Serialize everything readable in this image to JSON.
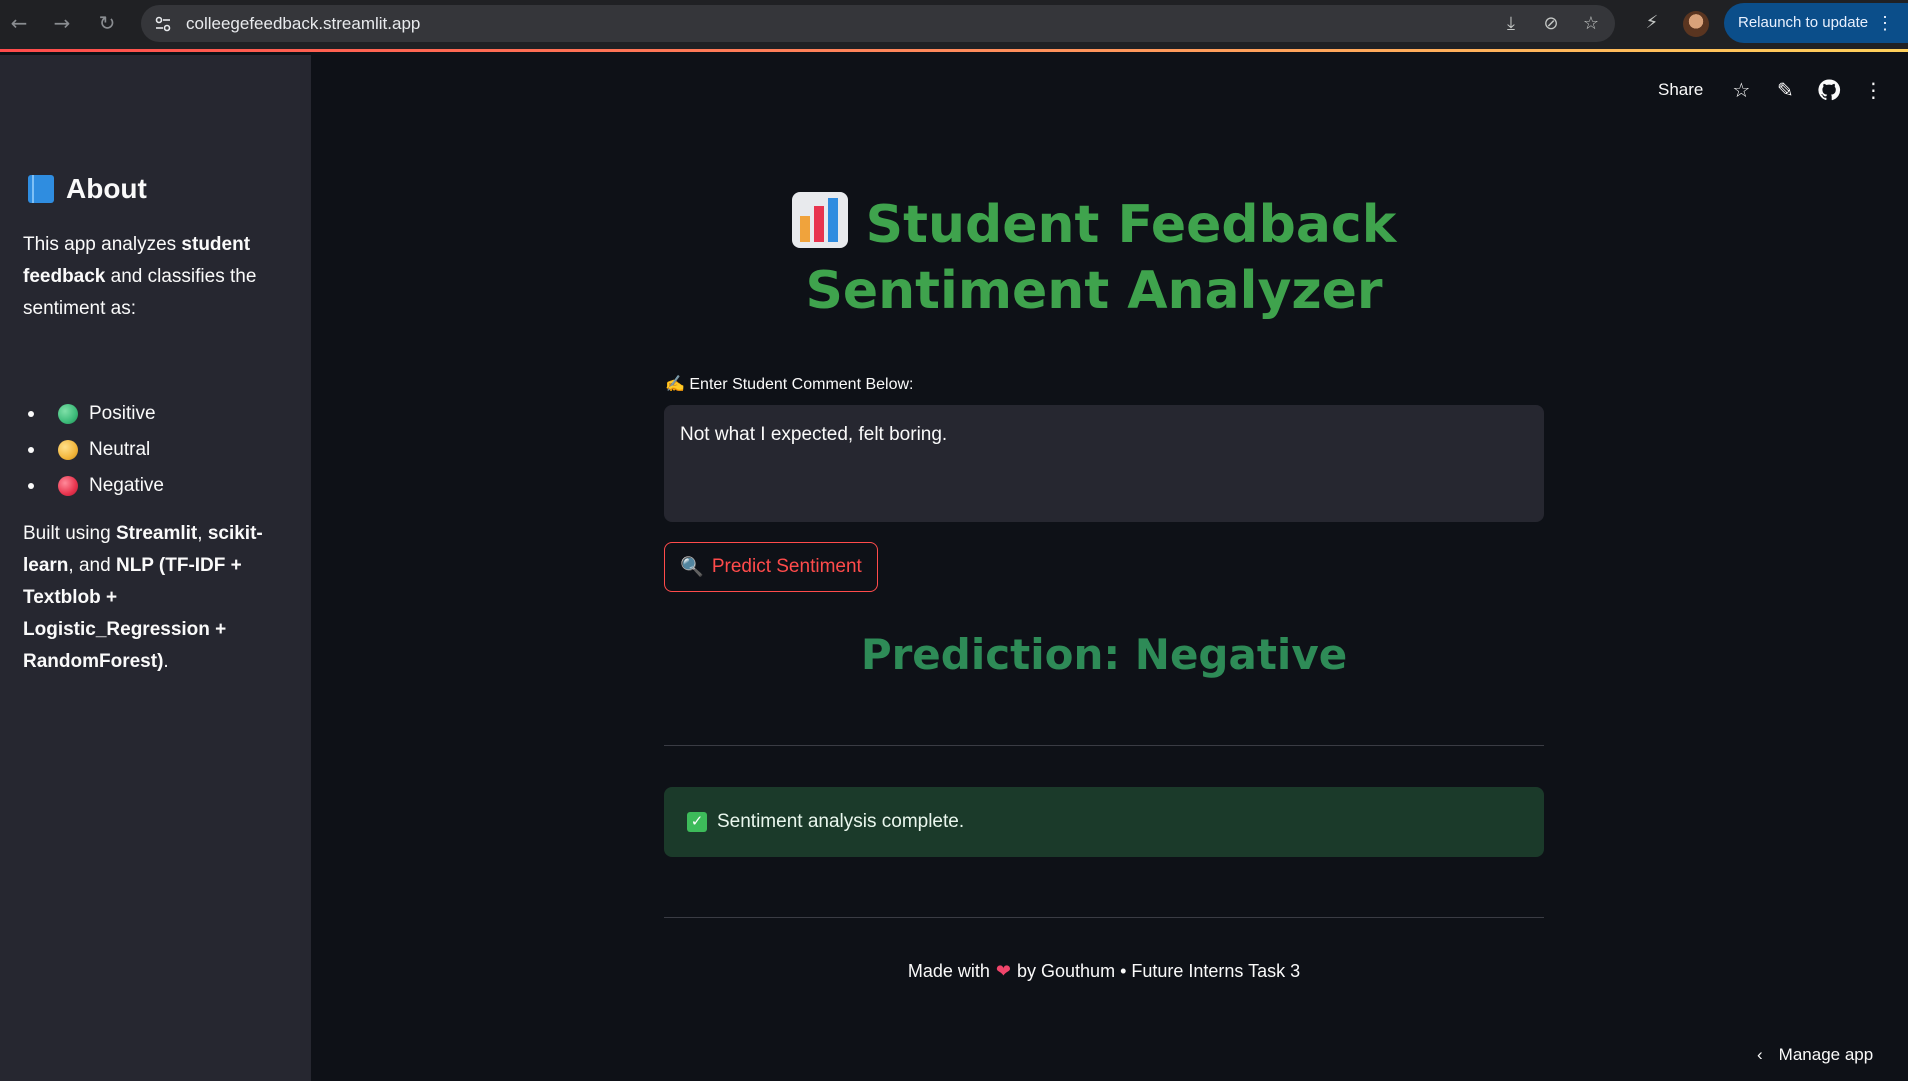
{
  "browser": {
    "url": "colleegefeedback.streamlit.app",
    "relaunch_label": "Relaunch to update",
    "icons": [
      "back-icon",
      "forward-icon",
      "reload-icon",
      "site-settings-icon",
      "install-icon",
      "eye-off-icon",
      "bookmark-star-icon",
      "extension-icon",
      "profile-avatar",
      "menu-dots-icon"
    ]
  },
  "toolbar": {
    "share_label": "Share",
    "icons": [
      "star-icon",
      "edit-icon",
      "github-icon",
      "more-vert-icon"
    ]
  },
  "sidebar": {
    "title": "About",
    "intro_1": "This app analyzes ",
    "intro_bold": "student feedback",
    "intro_2": " and classifies the sentiment as:",
    "sentiments": [
      {
        "label": "Positive",
        "color": "#3dbb7a"
      },
      {
        "label": "Neutral",
        "color": "#f2b63c"
      },
      {
        "label": "Negative",
        "color": "#e8344e"
      }
    ],
    "built_1": "Built using ",
    "built_b1": "Streamlit",
    "built_2": ", ",
    "built_b2": "scikit-learn",
    "built_3": ", and ",
    "built_b3": "NLP (TF-IDF + Textblob + Logistic_Regression + RandomForest)",
    "built_4": "."
  },
  "main": {
    "title": "Student Feedback Sentiment Analyzer",
    "input_label": "Enter Student Comment Below:",
    "input_value": "Not what I expected, felt boring.",
    "predict_button": "Predict Sentiment",
    "prediction": "Prediction: Negative",
    "success_message": "Sentiment analysis complete.",
    "footer_1": "Made with",
    "footer_2": "by Gouthum • Future Interns Task 3"
  },
  "manage_app": "Manage app",
  "colors": {
    "accent": "#ff4b4b",
    "title_green": "#3fa34d",
    "prediction_green": "#2e8b57",
    "background": "#0e1117",
    "sidebar_bg": "#262730",
    "success_bg": "#1b3a2a"
  }
}
